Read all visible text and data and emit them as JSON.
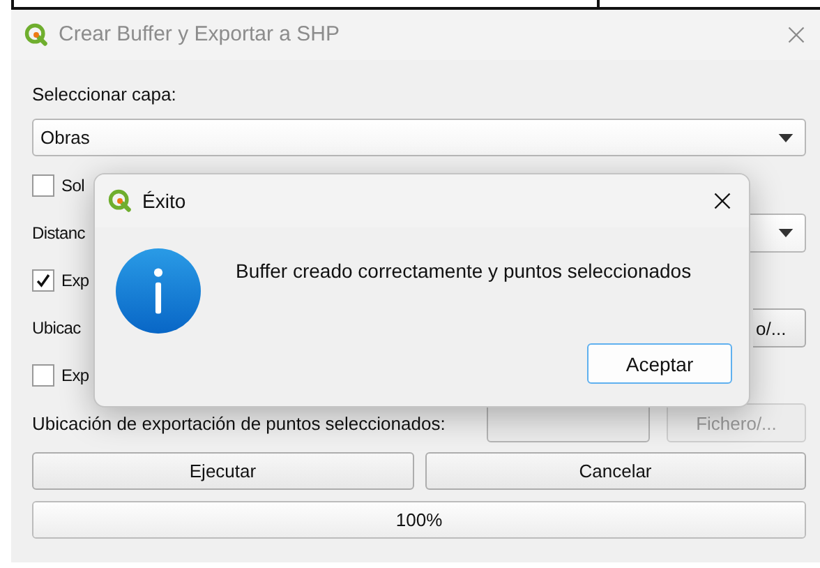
{
  "window": {
    "title": "Crear Buffer y Exportar a SHP"
  },
  "form": [
    {
      "kind": "label",
      "text": "Seleccionar capa:"
    },
    {
      "kind": "combo",
      "value": "Obras"
    },
    {
      "kind": "checkbox",
      "label": "Sol",
      "checked": false
    },
    {
      "kind": "combo_row",
      "label": "Distanc"
    },
    {
      "kind": "checkbox",
      "label": "Exp",
      "checked": true
    },
    {
      "kind": "file_row",
      "label": "Ubicac",
      "button": "o/...",
      "disabled": false
    },
    {
      "kind": "checkbox",
      "label": "Exp",
      "checked": false
    },
    {
      "kind": "path_row",
      "label": "Ubicación de exportación de puntos seleccionados:",
      "button": "Fichero/...",
      "disabled": true
    }
  ],
  "buttons": [
    "Ejecutar",
    "Cancelar"
  ],
  "progress": {
    "level": 1,
    "text": "100%"
  },
  "dialog": {
    "title": "Éxito",
    "message": "Buffer creado correctamente y puntos seleccionados",
    "button": "Aceptar"
  }
}
